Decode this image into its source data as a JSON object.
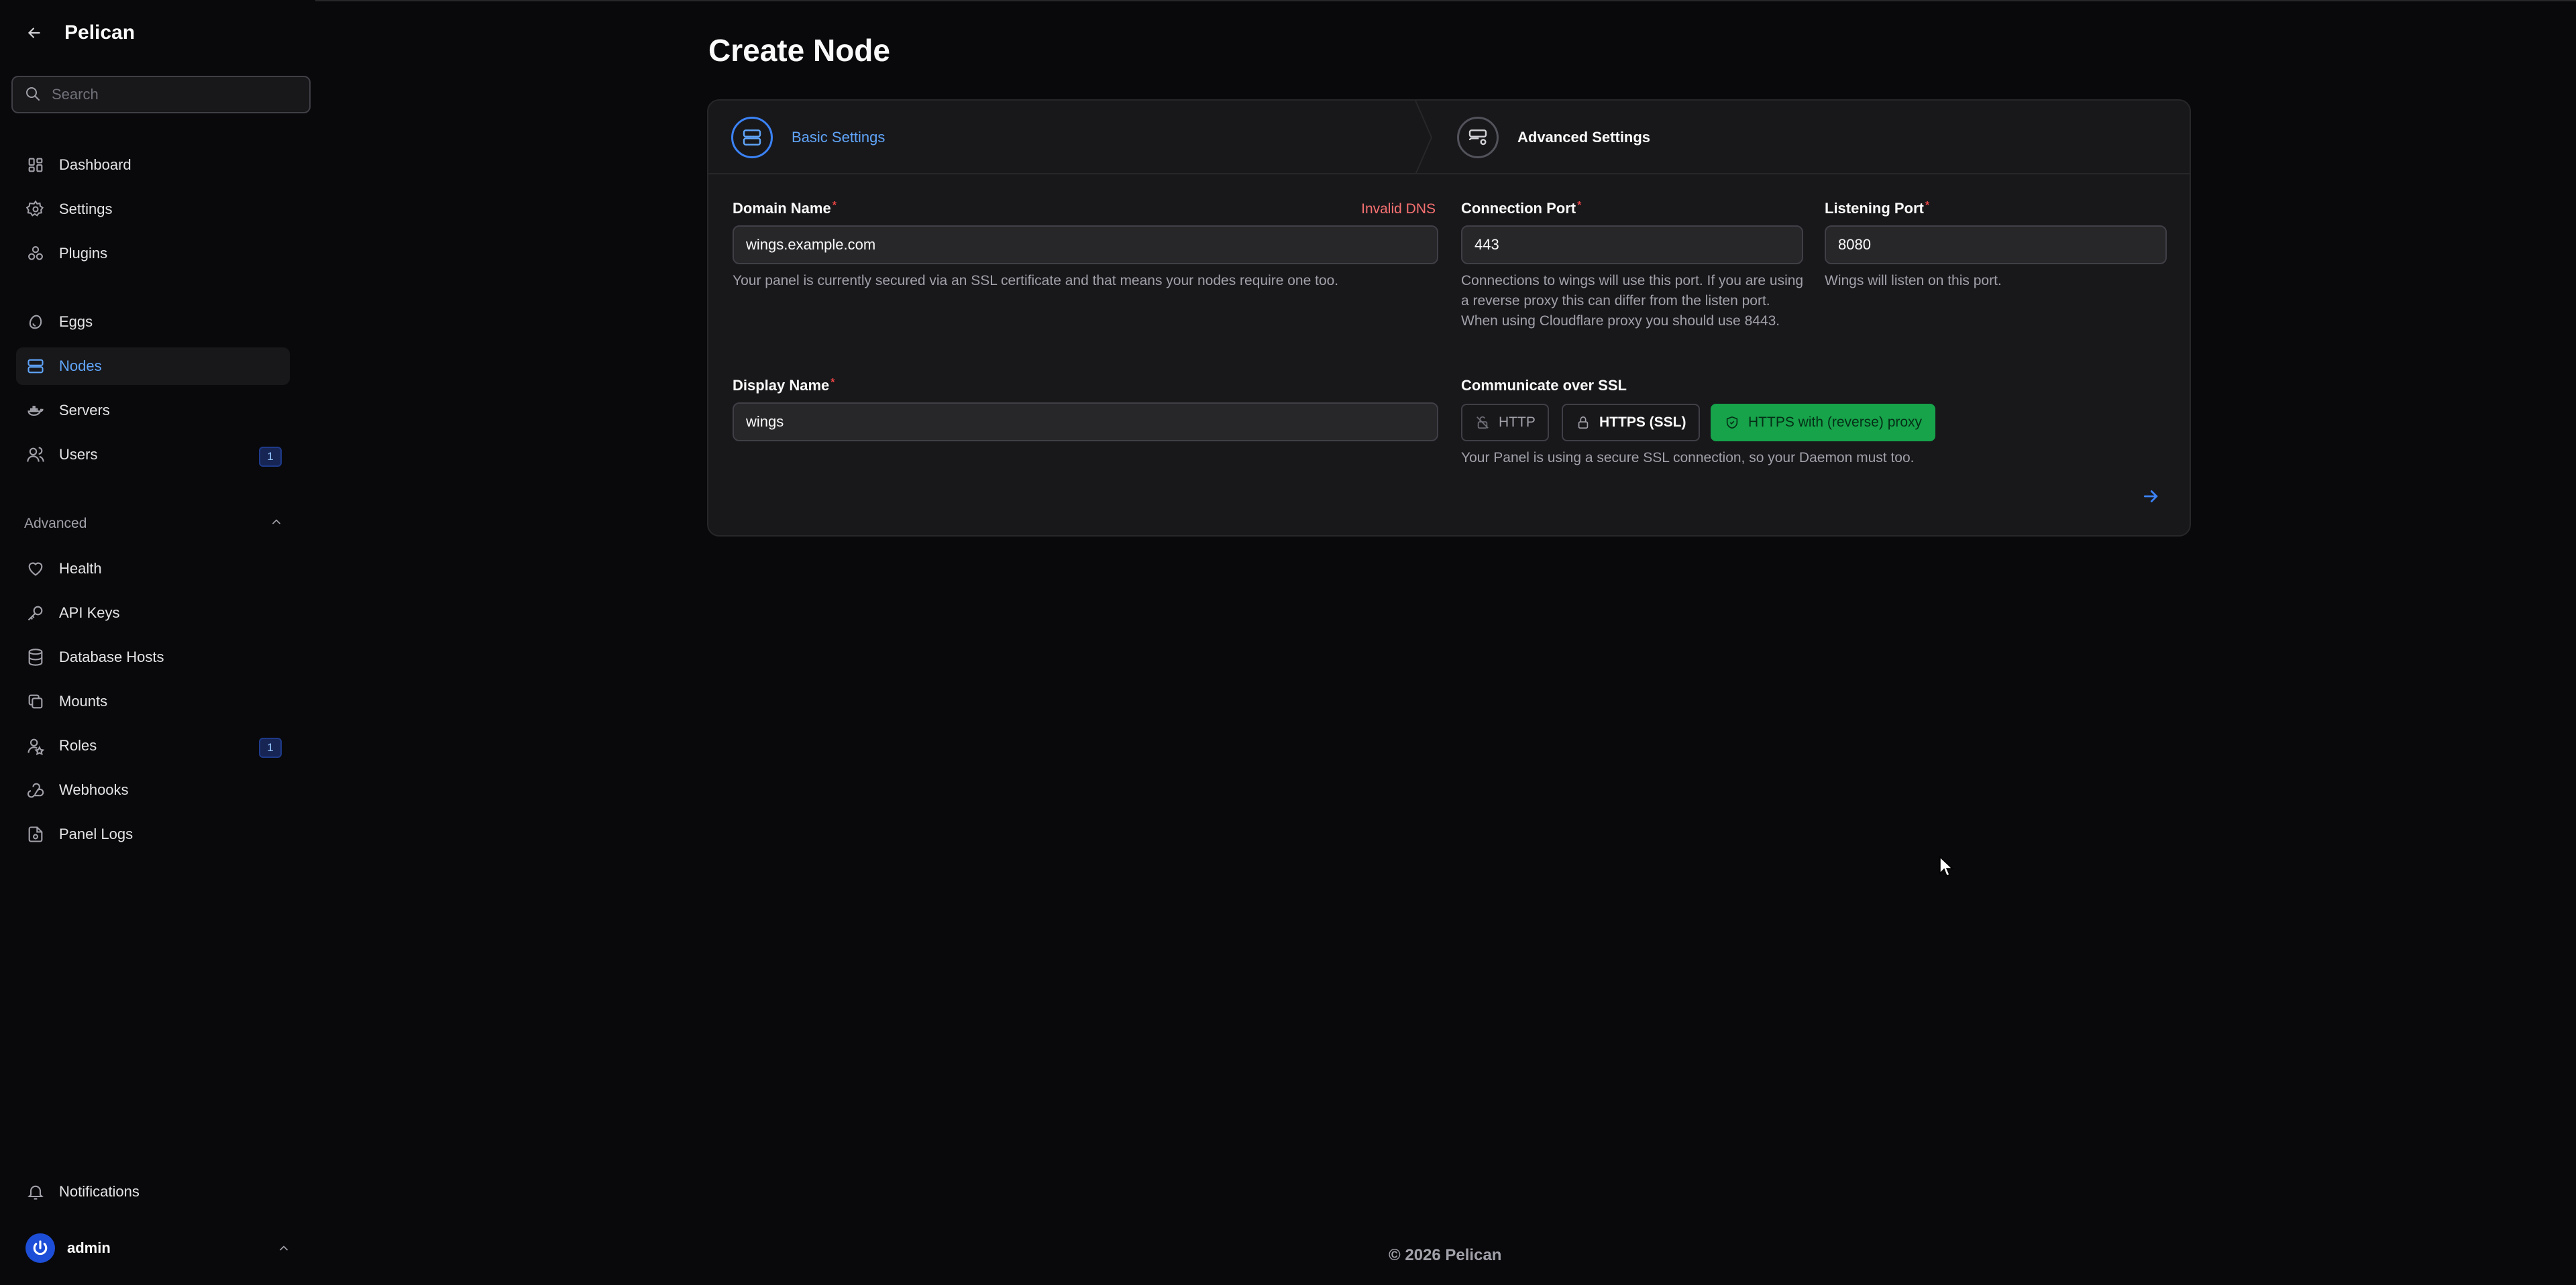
{
  "app": {
    "name": "Pelican"
  },
  "search": {
    "placeholder": "Search"
  },
  "sidebar": {
    "items": [
      {
        "label": "Dashboard",
        "icon": "dashboard-icon"
      },
      {
        "label": "Settings",
        "icon": "gear-icon"
      },
      {
        "label": "Plugins",
        "icon": "plugins-icon"
      },
      {
        "label": "Eggs",
        "icon": "egg-icon"
      },
      {
        "label": "Nodes",
        "icon": "server-icon",
        "active": true
      },
      {
        "label": "Servers",
        "icon": "brand-docker-icon"
      },
      {
        "label": "Users",
        "icon": "users-icon",
        "badge": "1"
      }
    ],
    "advanced_label": "Advanced",
    "advanced_items": [
      {
        "label": "Health",
        "icon": "heart-icon"
      },
      {
        "label": "API Keys",
        "icon": "key-icon"
      },
      {
        "label": "Database Hosts",
        "icon": "database-icon"
      },
      {
        "label": "Mounts",
        "icon": "mounts-icon"
      },
      {
        "label": "Roles",
        "icon": "roles-icon",
        "badge": "1"
      },
      {
        "label": "Webhooks",
        "icon": "webhook-icon"
      },
      {
        "label": "Panel Logs",
        "icon": "file-report-icon"
      }
    ],
    "notifications_label": "Notifications",
    "user_name": "admin"
  },
  "page": {
    "title": "Create Node"
  },
  "steps": [
    {
      "label": "Basic Settings",
      "state": "active"
    },
    {
      "label": "Advanced Settings",
      "state": "upcoming"
    }
  ],
  "form": {
    "domain": {
      "label": "Domain Name",
      "value": "wings.example.com",
      "error": "Invalid DNS",
      "help": "Your panel is currently secured via an SSL certificate and that means your nodes require one too."
    },
    "connection_port": {
      "label": "Connection Port",
      "value": "443",
      "help": "Connections to wings will use this port. If you are using a reverse proxy this can differ from the listen port. When using Cloudflare proxy you should use 8443."
    },
    "listening_port": {
      "label": "Listening Port",
      "value": "8080",
      "help": "Wings will listen on this port."
    },
    "display_name": {
      "label": "Display Name",
      "value": "wings"
    },
    "ssl": {
      "label": "Communicate over SSL",
      "options": [
        "HTTP",
        "HTTPS (SSL)",
        "HTTPS with (reverse) proxy"
      ],
      "selected": "HTTPS with (reverse) proxy",
      "help": "Your Panel is using a secure SSL connection, so your Daemon must too."
    },
    "required_mark": "*"
  },
  "footer": {
    "text": "© 2026 Pelican"
  },
  "colors": {
    "accent": "#3b82f6",
    "success": "#16a34a",
    "error": "#f87171",
    "background": "#09090b",
    "card": "#18181b"
  }
}
